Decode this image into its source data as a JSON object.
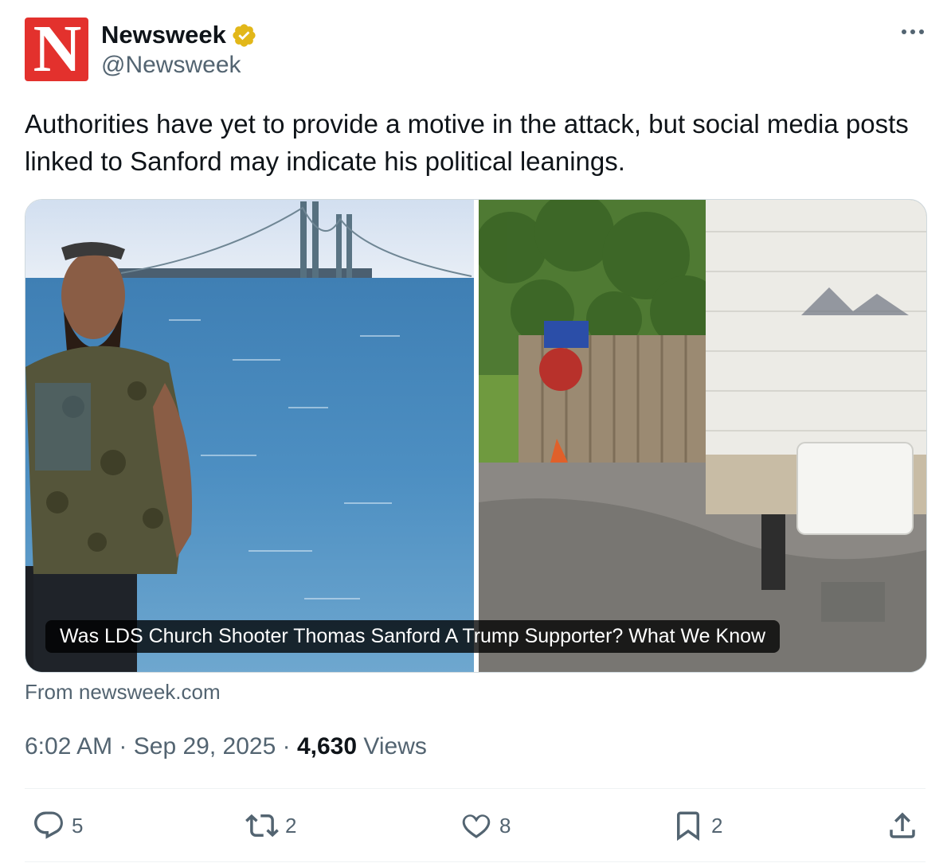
{
  "author": {
    "logo_letter": "N",
    "display_name": "Newsweek",
    "handle": "@Newsweek",
    "verified": true,
    "brand_color": "#e3312d",
    "verified_color": "#e2b719"
  },
  "tweet": {
    "text": "Authorities have yet to provide a motive in the attack, but social media posts linked to Sanford may indicate his political leanings."
  },
  "card": {
    "title": "Was LDS Church Shooter Thomas Sanford A Trump Supporter? What We Know",
    "source": "From newsweek.com",
    "left_image_icon": "photo-man-by-bridge",
    "right_image_icon": "photo-trailer-and-fence"
  },
  "meta": {
    "time": "6:02 AM",
    "date": "Sep 29, 2025",
    "views_count": "4,630",
    "views_label": "Views",
    "separator": "·"
  },
  "actions": {
    "replies": "5",
    "reposts": "2",
    "likes": "8",
    "bookmarks": "2"
  },
  "icons": {
    "more": "more-icon",
    "reply": "reply-icon",
    "repost": "repost-icon",
    "like": "heart-icon",
    "bookmark": "bookmark-icon",
    "share": "share-icon"
  }
}
